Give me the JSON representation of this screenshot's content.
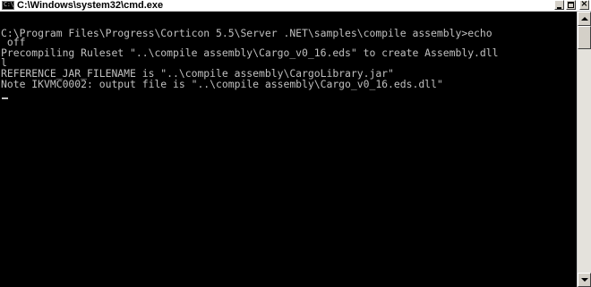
{
  "window": {
    "title": "C:\\Windows\\system32\\cmd.exe",
    "icon": "cmd-console-icon",
    "icon_glyph": "C:\\",
    "controls": {
      "minimize_icon": "minimize-icon",
      "maximize_icon": "maximize-icon",
      "close_icon": "close-icon",
      "close_glyph": "×"
    }
  },
  "console": {
    "foreground": "#c0c0c0",
    "background": "#000000",
    "lines": [
      "C:\\Program Files\\Progress\\Corticon 5.5\\Server .NET\\samples\\compile assembly>echo",
      " off",
      "Precompiling Ruleset \"..\\compile assembly\\Cargo_v0_16.eds\" to create Assembly.dll",
      "l",
      "REFERENCE_JAR_FILENAME is \"..\\compile assembly\\CargoLibrary.jar\"",
      "Note IKVMC0002: output file is \"..\\compile assembly\\Cargo_v0_16.eds.dll\""
    ]
  },
  "scrollbar": {
    "up_icon": "scroll-up-arrow-icon",
    "down_icon": "scroll-down-arrow-icon"
  }
}
